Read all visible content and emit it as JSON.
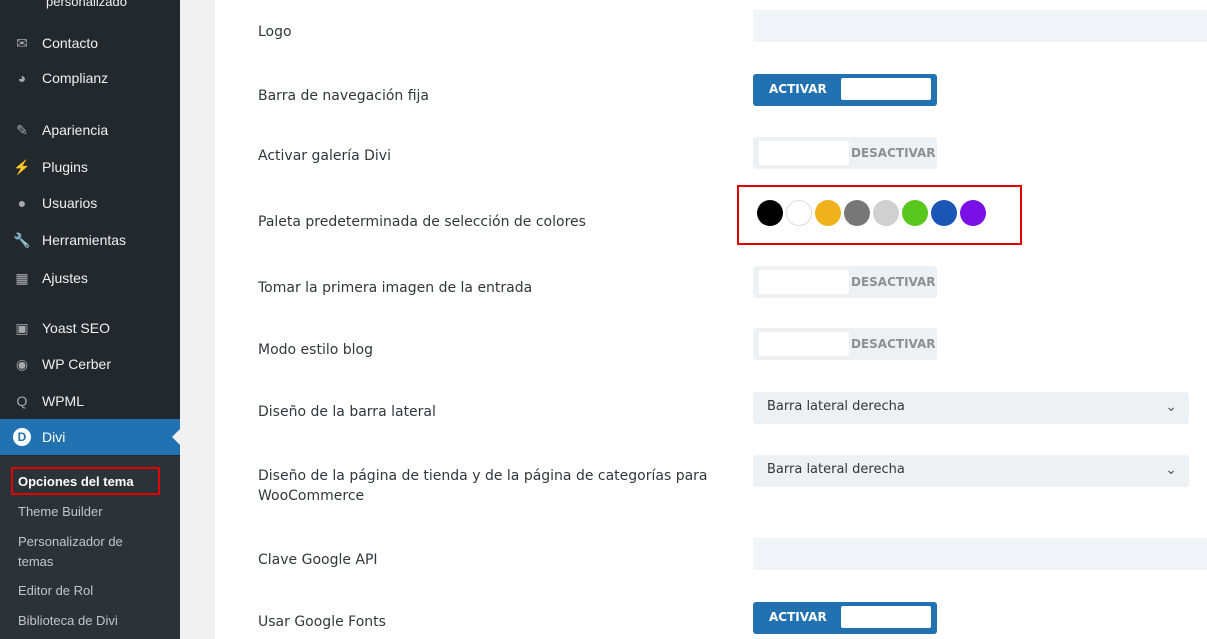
{
  "sidebar": {
    "cut_item": "personalizado",
    "items": [
      {
        "label": "Contacto",
        "icon": "envelope-icon"
      },
      {
        "label": "Complianz",
        "icon": "complianz-icon"
      },
      {
        "label": "Apariencia",
        "icon": "paintbrush-icon"
      },
      {
        "label": "Plugins",
        "icon": "plugin-icon"
      },
      {
        "label": "Usuarios",
        "icon": "users-icon"
      },
      {
        "label": "Herramientas",
        "icon": "wrench-icon"
      },
      {
        "label": "Ajustes",
        "icon": "settings-icon"
      },
      {
        "label": "Yoast SEO",
        "icon": "yoast-icon"
      },
      {
        "label": "WP Cerber",
        "icon": "cerber-icon"
      },
      {
        "label": "WPML",
        "icon": "wpml-icon"
      },
      {
        "label": "Divi",
        "icon": "divi-icon",
        "logo_letter": "D"
      }
    ],
    "submenu": [
      {
        "label": "Opciones del tema"
      },
      {
        "label": "Theme Builder"
      },
      {
        "label": "Personalizador de"
      },
      {
        "label": "temas"
      },
      {
        "label": "Editor de Rol"
      },
      {
        "label": "Biblioteca de Divi"
      }
    ]
  },
  "options": {
    "logo": "Logo",
    "fixed_nav": "Barra de navegación fija",
    "gallery": "Activar galería Divi",
    "palette": "Paleta predeterminada de selección de colores",
    "first_image": "Tomar la primera imagen de la entrada",
    "blog_mode": "Modo estilo blog",
    "sidebar_layout": "Diseño de la barra lateral",
    "shop_layout_1": "Diseño de la página de tienda y de la página de categorías para",
    "shop_layout_2": "WooCommerce",
    "google_api": "Clave Google API",
    "google_fonts": "Usar Google Fonts"
  },
  "controls": {
    "activar": "ACTIVAR",
    "desactivar": "DESACTIVAR",
    "sidebar_select": "Barra lateral derecha",
    "shop_select": "Barra lateral derecha"
  },
  "palette_colors": [
    "#000000",
    "#ffffff",
    "#f0b21c",
    "#777777",
    "#d0d0d0",
    "#5ac71e",
    "#1c56b5",
    "#7a10e5"
  ],
  "colors": {
    "accent": "#2271b1",
    "sidebar_bg": "#23282d",
    "highlight_border": "#e00000"
  }
}
